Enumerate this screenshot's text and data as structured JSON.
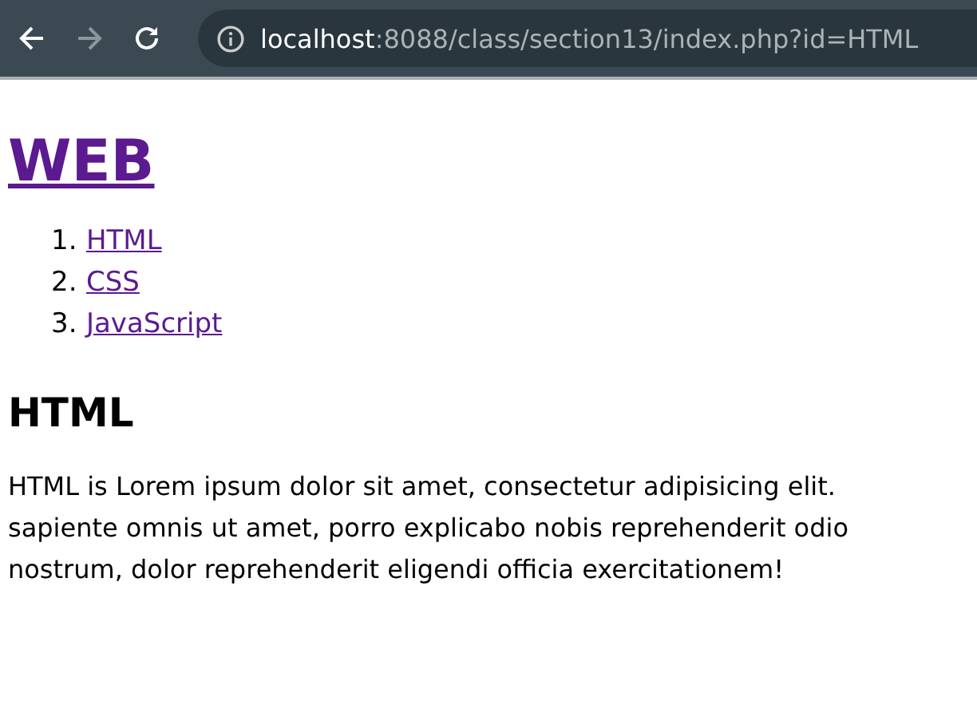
{
  "toolbar": {
    "back": {
      "disabled": false
    },
    "forward": {
      "disabled": true
    },
    "url": {
      "host": "localhost",
      "rest": ":8088/class/section13/index.php?id=HTML"
    }
  },
  "page": {
    "title": "WEB",
    "links": [
      {
        "number": "1.",
        "label": "HTML"
      },
      {
        "number": "2.",
        "label": "CSS"
      },
      {
        "number": "3.",
        "label": "JavaScript"
      }
    ],
    "heading": "HTML",
    "paragraph_lines": [
      "HTML is Lorem ipsum dolor sit amet, consectetur adipisicing elit.",
      "sapiente omnis ut amet, porro explicabo nobis reprehenderit odio",
      "nostrum, dolor reprehenderit eligendi officia exercitationem!"
    ]
  }
}
